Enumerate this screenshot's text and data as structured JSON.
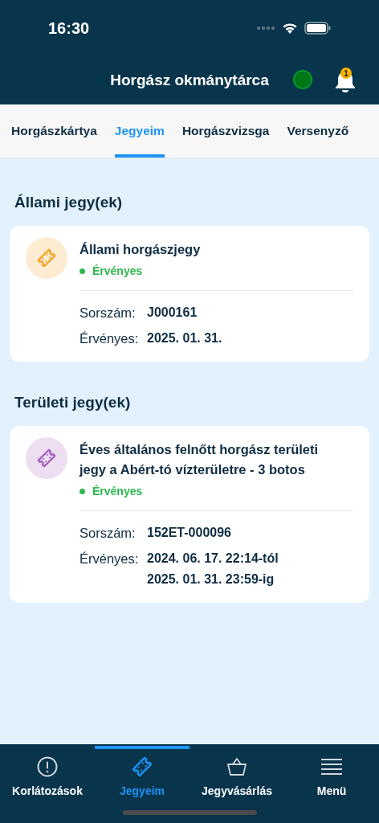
{
  "status_bar": {
    "time": "16:30"
  },
  "header": {
    "title": "Horgász okmánytárca",
    "notification_count": "1"
  },
  "tabs": [
    {
      "label": "Horgászkártya",
      "selected": false
    },
    {
      "label": "Jegyeim",
      "selected": true
    },
    {
      "label": "Horgászvizsga",
      "selected": false
    },
    {
      "label": "Versenyző",
      "selected": false
    }
  ],
  "sections": [
    {
      "title": "Állami jegy(ek)",
      "tickets": [
        {
          "name": "Állami horgászjegy",
          "color": "#f5a020",
          "status": "Érvényes",
          "fields": [
            {
              "label": "Sorszám:",
              "values": [
                "J000161"
              ]
            },
            {
              "label": "Érvényes:",
              "values": [
                "2025. 01. 31."
              ]
            }
          ]
        }
      ]
    },
    {
      "title": "Területi jegy(ek)",
      "tickets": [
        {
          "name": "Éves általános felnőtt horgász területi jegy a Abért-tó vízterületre - 3 botos",
          "color": "#a45cc0",
          "status": "Érvényes",
          "fields": [
            {
              "label": "Sorszám:",
              "values": [
                "152ET-000096"
              ]
            },
            {
              "label": "Érvényes:",
              "values": [
                "2024. 06. 17. 22:14-tól",
                "2025. 01. 31. 23:59-ig"
              ]
            }
          ]
        }
      ]
    }
  ],
  "bottom_nav": [
    {
      "label": "Korlátozások",
      "selected": false
    },
    {
      "label": "Jegyeim",
      "selected": true
    },
    {
      "label": "Jegyvásárlás",
      "selected": false
    },
    {
      "label": "Menü",
      "selected": false
    }
  ]
}
